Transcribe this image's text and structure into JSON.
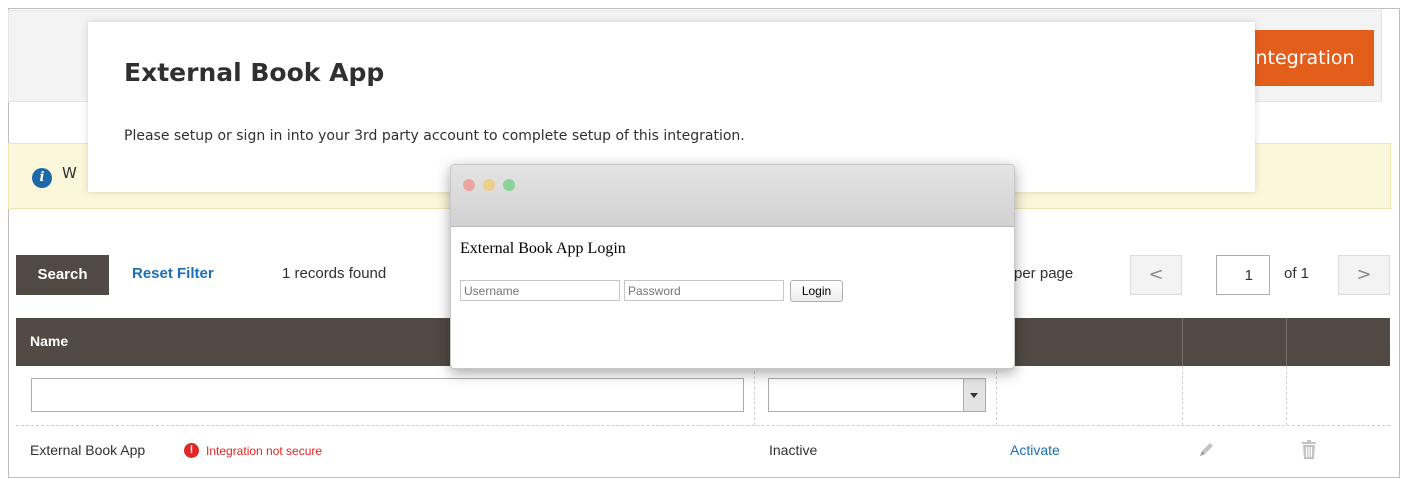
{
  "header": {
    "add_button_label": "ntegration"
  },
  "notice": {
    "text": "W",
    "icon": "info-icon"
  },
  "toolbar": {
    "search_label": "Search",
    "reset_filter_label": "Reset Filter",
    "records_found": "1 records found",
    "per_page_label": "per page",
    "prev_icon": "<",
    "next_icon": ">",
    "current_page": "1",
    "total_pages": "of 1"
  },
  "grid": {
    "columns": [
      "Name",
      "",
      "",
      "",
      ""
    ],
    "rows": [
      {
        "name": "External Book App",
        "warning": "Integration not secure",
        "status": "Inactive",
        "action": "Activate",
        "edit_icon": "pencil-icon",
        "delete_icon": "trash-icon"
      }
    ]
  },
  "modal": {
    "title": "External Book App",
    "text": "Please setup or sign in into your 3rd party account to complete setup of this integration."
  },
  "popup": {
    "title": "External Book App Login",
    "username_placeholder": "Username",
    "password_placeholder": "Password",
    "login_label": "Login"
  },
  "colors": {
    "accent": "#e35d1b",
    "grid_header": "#514943",
    "link": "#1a6fb5",
    "error": "#e22626",
    "notice_bg": "#fbf7da"
  }
}
